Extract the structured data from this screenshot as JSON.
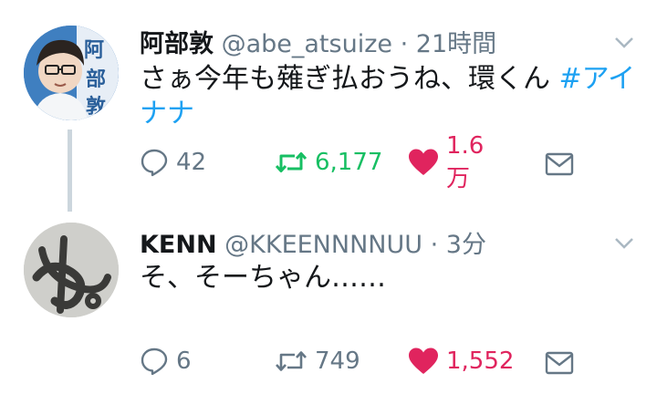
{
  "colors": {
    "text": "#14171a",
    "meta": "#657786",
    "link": "#1da1f2",
    "retweet": "#17bf63",
    "like": "#e0245e",
    "thread": "#ccd6dd"
  },
  "tweets": [
    {
      "display_name": "阿部敦",
      "handle": "@abe_atsuize",
      "time": "21時間",
      "text": "さぁ今年も薙ぎ払おうね、環くん ",
      "hashtag": "#アイナナ",
      "avatar_text": "阿部敦",
      "replies": "42",
      "retweets": "6,177",
      "likes": "1.6万",
      "icons": [
        "reply-icon",
        "retweet-icon",
        "heart-icon",
        "mail-icon",
        "chevron-down-icon"
      ]
    },
    {
      "display_name": "KENN",
      "handle": "@KKEENNNNUU",
      "time": "3分",
      "text": "そ、そーちゃん……",
      "avatar_text": "ぬ",
      "replies": "6",
      "retweets": "749",
      "likes": "1,552",
      "icons": [
        "reply-icon",
        "retweet-icon",
        "heart-icon",
        "mail-icon",
        "chevron-down-icon"
      ]
    }
  ]
}
